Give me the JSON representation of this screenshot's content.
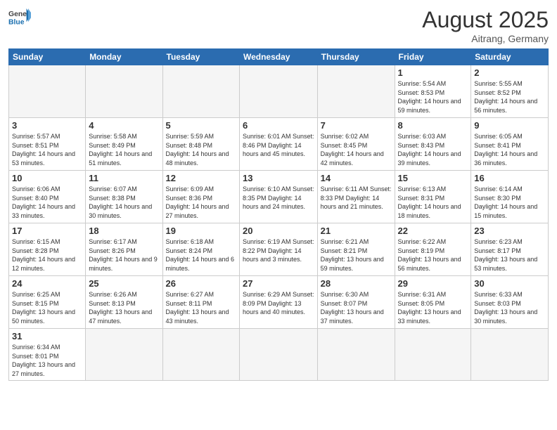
{
  "header": {
    "logo_general": "General",
    "logo_blue": "Blue",
    "month_title": "August 2025",
    "subtitle": "Aitrang, Germany"
  },
  "weekdays": [
    "Sunday",
    "Monday",
    "Tuesday",
    "Wednesday",
    "Thursday",
    "Friday",
    "Saturday"
  ],
  "weeks": [
    [
      {
        "day": "",
        "info": ""
      },
      {
        "day": "",
        "info": ""
      },
      {
        "day": "",
        "info": ""
      },
      {
        "day": "",
        "info": ""
      },
      {
        "day": "",
        "info": ""
      },
      {
        "day": "1",
        "info": "Sunrise: 5:54 AM\nSunset: 8:53 PM\nDaylight: 14 hours\nand 59 minutes."
      },
      {
        "day": "2",
        "info": "Sunrise: 5:55 AM\nSunset: 8:52 PM\nDaylight: 14 hours\nand 56 minutes."
      }
    ],
    [
      {
        "day": "3",
        "info": "Sunrise: 5:57 AM\nSunset: 8:51 PM\nDaylight: 14 hours\nand 53 minutes."
      },
      {
        "day": "4",
        "info": "Sunrise: 5:58 AM\nSunset: 8:49 PM\nDaylight: 14 hours\nand 51 minutes."
      },
      {
        "day": "5",
        "info": "Sunrise: 5:59 AM\nSunset: 8:48 PM\nDaylight: 14 hours\nand 48 minutes."
      },
      {
        "day": "6",
        "info": "Sunrise: 6:01 AM\nSunset: 8:46 PM\nDaylight: 14 hours\nand 45 minutes."
      },
      {
        "day": "7",
        "info": "Sunrise: 6:02 AM\nSunset: 8:45 PM\nDaylight: 14 hours\nand 42 minutes."
      },
      {
        "day": "8",
        "info": "Sunrise: 6:03 AM\nSunset: 8:43 PM\nDaylight: 14 hours\nand 39 minutes."
      },
      {
        "day": "9",
        "info": "Sunrise: 6:05 AM\nSunset: 8:41 PM\nDaylight: 14 hours\nand 36 minutes."
      }
    ],
    [
      {
        "day": "10",
        "info": "Sunrise: 6:06 AM\nSunset: 8:40 PM\nDaylight: 14 hours\nand 33 minutes."
      },
      {
        "day": "11",
        "info": "Sunrise: 6:07 AM\nSunset: 8:38 PM\nDaylight: 14 hours\nand 30 minutes."
      },
      {
        "day": "12",
        "info": "Sunrise: 6:09 AM\nSunset: 8:36 PM\nDaylight: 14 hours\nand 27 minutes."
      },
      {
        "day": "13",
        "info": "Sunrise: 6:10 AM\nSunset: 8:35 PM\nDaylight: 14 hours\nand 24 minutes."
      },
      {
        "day": "14",
        "info": "Sunrise: 6:11 AM\nSunset: 8:33 PM\nDaylight: 14 hours\nand 21 minutes."
      },
      {
        "day": "15",
        "info": "Sunrise: 6:13 AM\nSunset: 8:31 PM\nDaylight: 14 hours\nand 18 minutes."
      },
      {
        "day": "16",
        "info": "Sunrise: 6:14 AM\nSunset: 8:30 PM\nDaylight: 14 hours\nand 15 minutes."
      }
    ],
    [
      {
        "day": "17",
        "info": "Sunrise: 6:15 AM\nSunset: 8:28 PM\nDaylight: 14 hours\nand 12 minutes."
      },
      {
        "day": "18",
        "info": "Sunrise: 6:17 AM\nSunset: 8:26 PM\nDaylight: 14 hours\nand 9 minutes."
      },
      {
        "day": "19",
        "info": "Sunrise: 6:18 AM\nSunset: 8:24 PM\nDaylight: 14 hours\nand 6 minutes."
      },
      {
        "day": "20",
        "info": "Sunrise: 6:19 AM\nSunset: 8:22 PM\nDaylight: 14 hours\nand 3 minutes."
      },
      {
        "day": "21",
        "info": "Sunrise: 6:21 AM\nSunset: 8:21 PM\nDaylight: 13 hours\nand 59 minutes."
      },
      {
        "day": "22",
        "info": "Sunrise: 6:22 AM\nSunset: 8:19 PM\nDaylight: 13 hours\nand 56 minutes."
      },
      {
        "day": "23",
        "info": "Sunrise: 6:23 AM\nSunset: 8:17 PM\nDaylight: 13 hours\nand 53 minutes."
      }
    ],
    [
      {
        "day": "24",
        "info": "Sunrise: 6:25 AM\nSunset: 8:15 PM\nDaylight: 13 hours\nand 50 minutes."
      },
      {
        "day": "25",
        "info": "Sunrise: 6:26 AM\nSunset: 8:13 PM\nDaylight: 13 hours\nand 47 minutes."
      },
      {
        "day": "26",
        "info": "Sunrise: 6:27 AM\nSunset: 8:11 PM\nDaylight: 13 hours\nand 43 minutes."
      },
      {
        "day": "27",
        "info": "Sunrise: 6:29 AM\nSunset: 8:09 PM\nDaylight: 13 hours\nand 40 minutes."
      },
      {
        "day": "28",
        "info": "Sunrise: 6:30 AM\nSunset: 8:07 PM\nDaylight: 13 hours\nand 37 minutes."
      },
      {
        "day": "29",
        "info": "Sunrise: 6:31 AM\nSunset: 8:05 PM\nDaylight: 13 hours\nand 33 minutes."
      },
      {
        "day": "30",
        "info": "Sunrise: 6:33 AM\nSunset: 8:03 PM\nDaylight: 13 hours\nand 30 minutes."
      }
    ],
    [
      {
        "day": "31",
        "info": "Sunrise: 6:34 AM\nSunset: 8:01 PM\nDaylight: 13 hours\nand 27 minutes."
      },
      {
        "day": "",
        "info": ""
      },
      {
        "day": "",
        "info": ""
      },
      {
        "day": "",
        "info": ""
      },
      {
        "day": "",
        "info": ""
      },
      {
        "day": "",
        "info": ""
      },
      {
        "day": "",
        "info": ""
      }
    ]
  ]
}
